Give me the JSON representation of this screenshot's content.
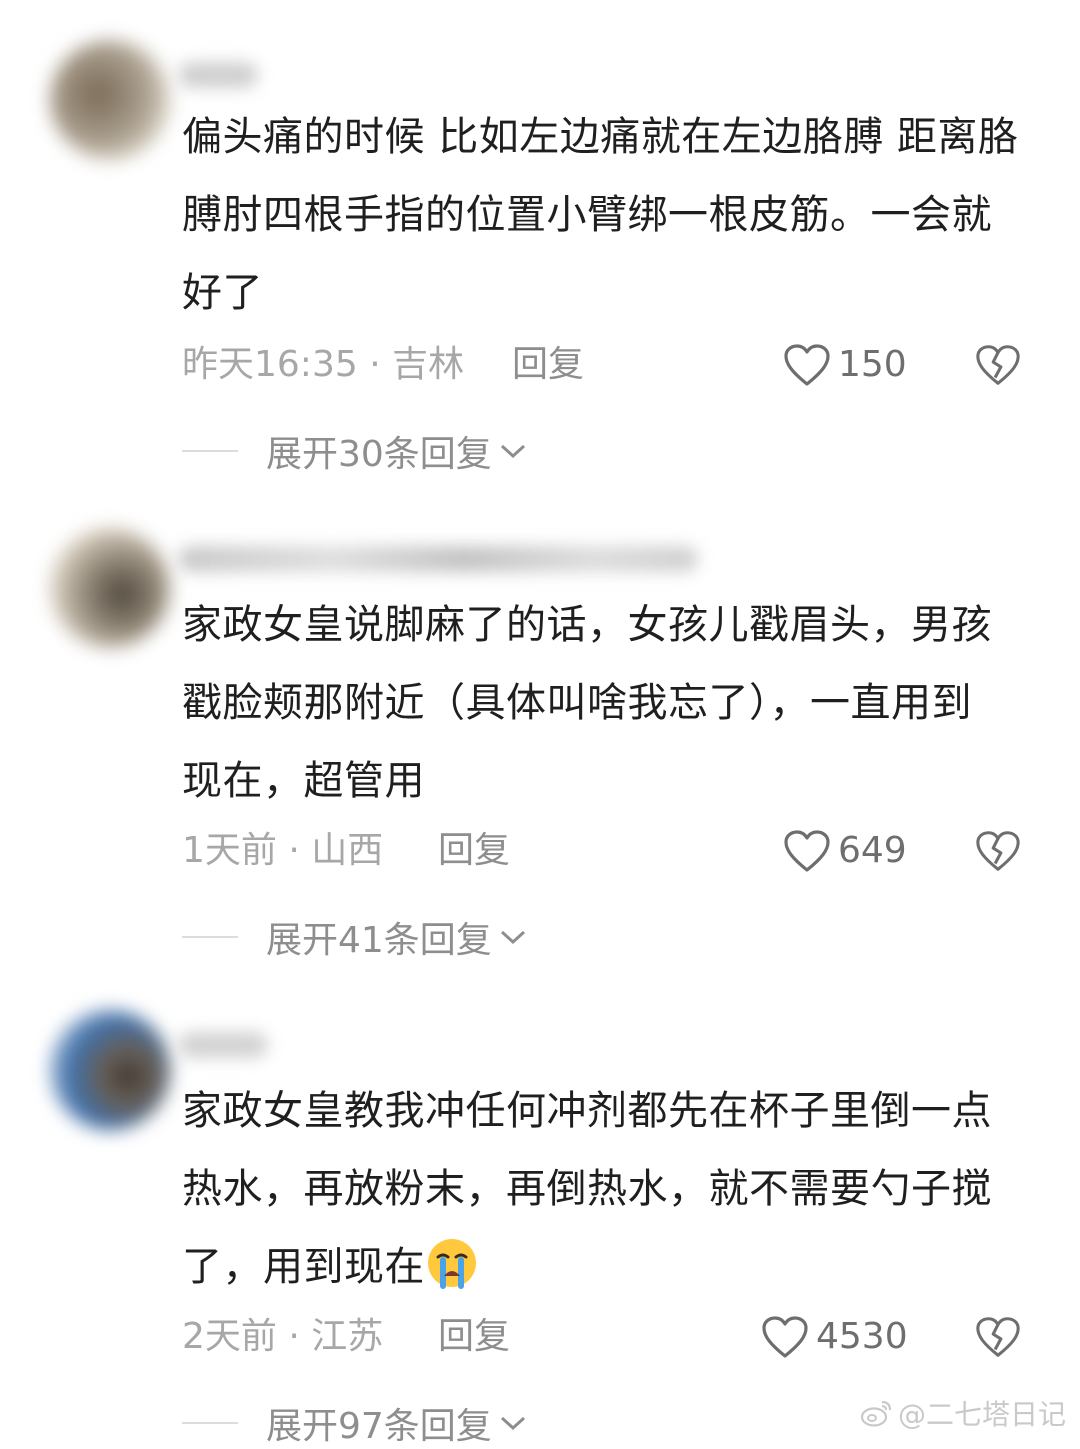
{
  "comments": [
    {
      "text": "偏头痛的时候 比如左边痛就在左边胳膊 距离胳膊肘四根手指的位置小臂绑一根皮筋。一会就好了",
      "time_location": "昨天16:35 · 吉林",
      "reply_label": "回复",
      "likes": "150",
      "expand_label": "展开30条回复"
    },
    {
      "text": "家政女皇说脚麻了的话，女孩儿戳眉头，男孩戳脸颊那附近（具体叫啥我忘了），一直用到现在，超管用",
      "time_location": "1天前 · 山西",
      "reply_label": "回复",
      "likes": "649",
      "expand_label": "展开41条回复"
    },
    {
      "text": "家政女皇教我冲任何冲剂都先在杯子里倒一点热水，再放粉末，再倒热水，就不需要勺子搅了，用到现在",
      "emoji": "crying-face",
      "time_location": "2天前 · 江苏",
      "reply_label": "回复",
      "likes": "4530",
      "expand_label": "展开97条回复"
    }
  ],
  "icons": {
    "like": "heart-outline-icon",
    "dislike": "broken-heart-icon",
    "expand": "chevron-down-icon",
    "watermark": "weibo-logo-icon"
  },
  "watermark": "@二七塔日记",
  "colors": {
    "text": "#1f1f1f",
    "meta": "#a7a7a7",
    "icon": "#6e6e6e"
  }
}
